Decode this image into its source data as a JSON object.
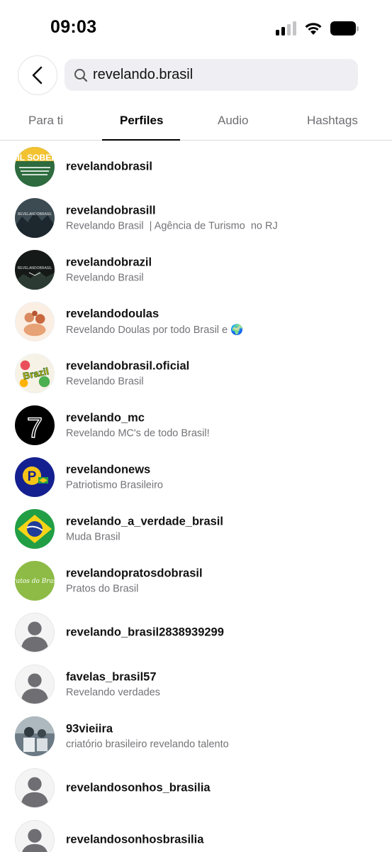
{
  "status_bar": {
    "time": "09:03",
    "icons": [
      "cellular-signal-icon",
      "wifi-icon",
      "battery-icon"
    ]
  },
  "search": {
    "value": "revelando.brasil",
    "icons": [
      "back-arrow-icon",
      "search-icon"
    ]
  },
  "tabs": [
    {
      "label": "Para ti",
      "active": false
    },
    {
      "label": "Perfiles",
      "active": true
    },
    {
      "label": "Audio",
      "active": false
    },
    {
      "label": "Hashtags",
      "active": false
    }
  ],
  "profiles": [
    {
      "username": "revelandobrasil",
      "name": "",
      "avatar_text": "BRASIL SOBERANO"
    },
    {
      "username": "revelandobrasill",
      "name": "Revelando Brasil  | Agência de Turismo  no RJ",
      "avatar_text": "REVELANDOBRASIL"
    },
    {
      "username": "revelandobrazil",
      "name": "Revelando Brasil",
      "avatar_text": "REVELANDOBRASIL"
    },
    {
      "username": "revelandodoulas",
      "name": "Revelando Doulas por todo Brasil e 🌍",
      "avatar_text": ""
    },
    {
      "username": "revelandobrasil.oficial",
      "name": "Revelando Brasil",
      "avatar_text": "Brazil"
    },
    {
      "username": "revelando_mc",
      "name": "Revelando MC's de todo Brasil!",
      "avatar_text": "7"
    },
    {
      "username": "revelandonews",
      "name": "Patriotismo Brasileiro",
      "avatar_text": "P"
    },
    {
      "username": "revelando_a_verdade_brasil",
      "name": "Muda Brasil",
      "avatar_text": ""
    },
    {
      "username": "revelandopratosdobrasil",
      "name": "Pratos do Brasil",
      "avatar_text": "Pratos do Brasil"
    },
    {
      "username": "revelando_brasil2838939299",
      "name": "",
      "avatar_text": ""
    },
    {
      "username": "favelas_brasil57",
      "name": "Revelando verdades",
      "avatar_text": ""
    },
    {
      "username": "93vieiira",
      "name": "criatório brasileiro revelando talento",
      "avatar_text": ""
    },
    {
      "username": "revelandosonhos_brasilia",
      "name": "",
      "avatar_text": ""
    },
    {
      "username": "revelandosonhosbrasilia",
      "name": "",
      "avatar_text": ""
    }
  ]
}
